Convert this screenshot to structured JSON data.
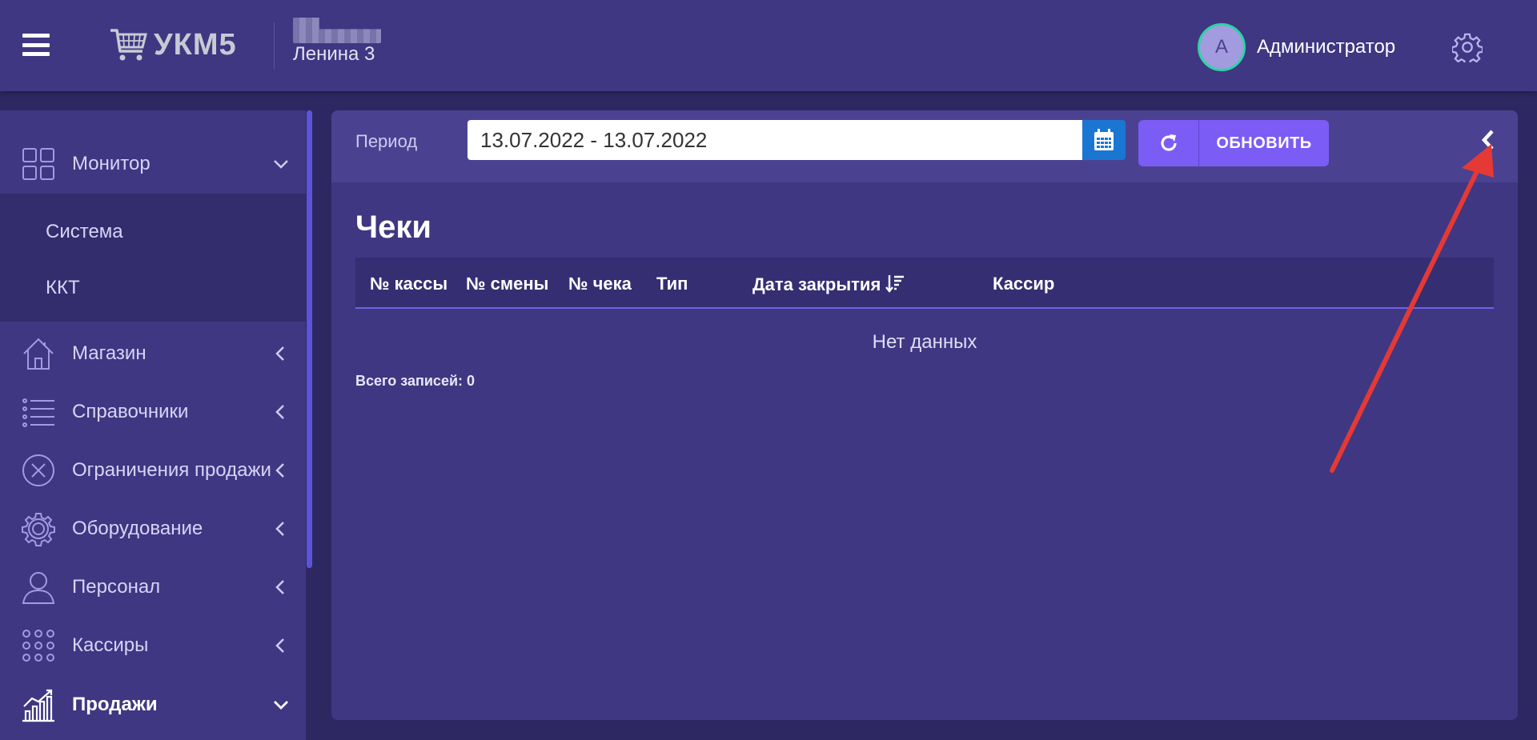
{
  "header": {
    "logo_text": "УКМ5",
    "store_name": "Ленина 3",
    "user_initial": "А",
    "user_name": "Администратор"
  },
  "sidebar": {
    "items": [
      {
        "label": "Монитор",
        "icon": "dashboard-icon",
        "expanded": true
      },
      {
        "label": "Магазин",
        "icon": "home-icon",
        "expanded": false
      },
      {
        "label": "Справочники",
        "icon": "list-icon",
        "expanded": false
      },
      {
        "label": "Ограничения продажи",
        "icon": "close-circle-icon",
        "expanded": false
      },
      {
        "label": "Оборудование",
        "icon": "gear-icon",
        "expanded": false
      },
      {
        "label": "Персонал",
        "icon": "person-icon",
        "expanded": false
      },
      {
        "label": "Кассиры",
        "icon": "keypad-icon",
        "expanded": false
      },
      {
        "label": "Продажи",
        "icon": "chart-icon",
        "expanded": true,
        "active": true
      }
    ],
    "monitor_submenu": [
      "Система",
      "ККТ"
    ]
  },
  "filter": {
    "period_label": "Период",
    "date_range": "13.07.2022 - 13.07.2022",
    "refresh_label": "ОБНОВИТЬ"
  },
  "page": {
    "title": "Чеки",
    "columns": [
      "№ кассы",
      "№ смены",
      "№ чека",
      "Тип",
      "Дата закрытия",
      "Кассир"
    ],
    "empty_text": "Нет данных",
    "total_records": "Всего записей: 0"
  },
  "colors": {
    "background": "#2d2862",
    "panel": "#3f3782",
    "accent": "#7b5cf5",
    "calendar_button": "#1a76d2",
    "avatar_ring": "#2ed3a5",
    "annotation_arrow": "#e53935"
  }
}
